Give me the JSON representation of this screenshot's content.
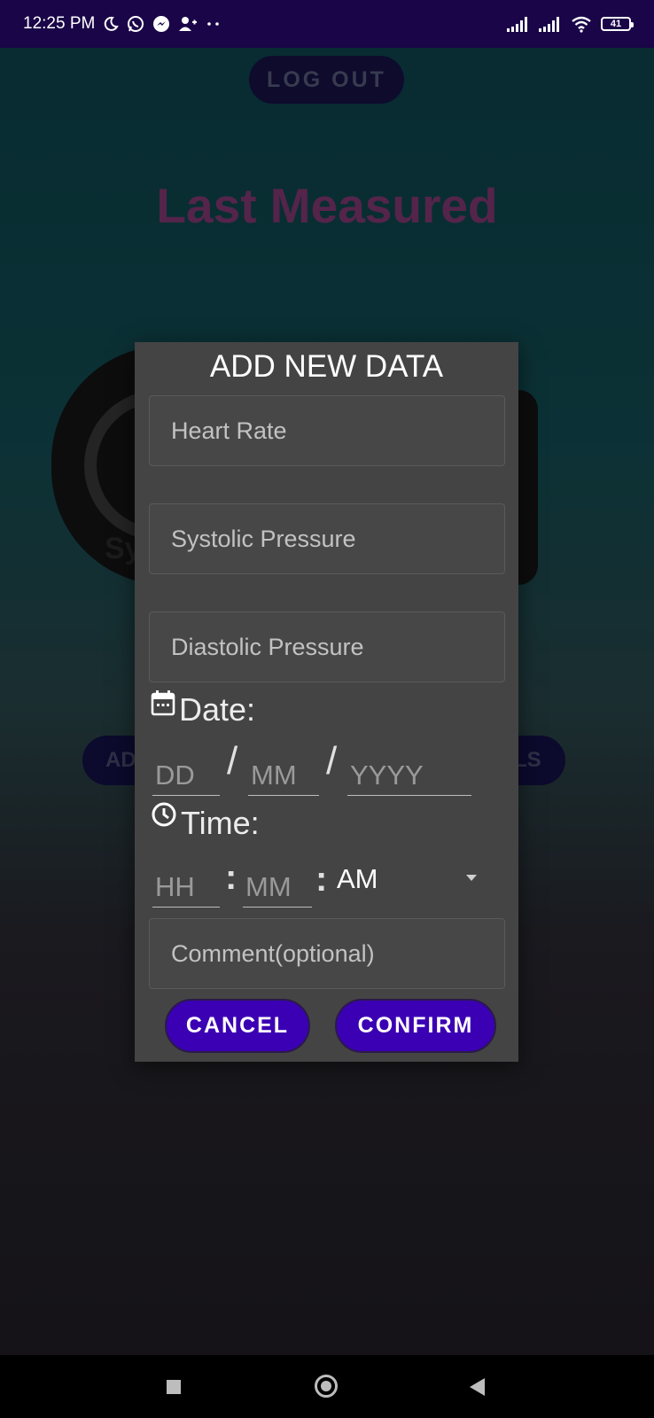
{
  "status_bar": {
    "time": "12:25 PM",
    "battery": "41",
    "left_icons": [
      "moon-icon",
      "whatsapp-icon",
      "messenger-icon",
      "account-icon",
      "more-dots-icon"
    ],
    "right_icons": [
      "signal-icon",
      "signal-icon-2",
      "wifi-icon",
      "battery-icon"
    ]
  },
  "background": {
    "logout_label": "LOG OUT",
    "heading": "Last Measured",
    "gauge_label_partial": "Sy",
    "left_button_partial": "AD",
    "right_button_partial": "LS"
  },
  "dialog": {
    "title": "ADD NEW DATA",
    "heart_rate_placeholder": "Heart Rate",
    "systolic_placeholder": "Systolic Pressure",
    "diastolic_placeholder": "Diastolic Pressure",
    "date_label": "Date:",
    "day_placeholder": "DD",
    "month_placeholder": "MM",
    "year_placeholder": "YYYY",
    "date_separator": "/",
    "time_label": "Time:",
    "hour_placeholder": "HH",
    "minute_placeholder": "MM",
    "ampm_value": "AM",
    "comment_placeholder": "Comment(optional)",
    "cancel_label": "CANCEL",
    "confirm_label": "CONFIRM"
  },
  "colors": {
    "status_bar": "#1a0548",
    "dialog_bg": "#444444",
    "button_bg": "#3b00b3",
    "heading": "#8a3a7a"
  }
}
